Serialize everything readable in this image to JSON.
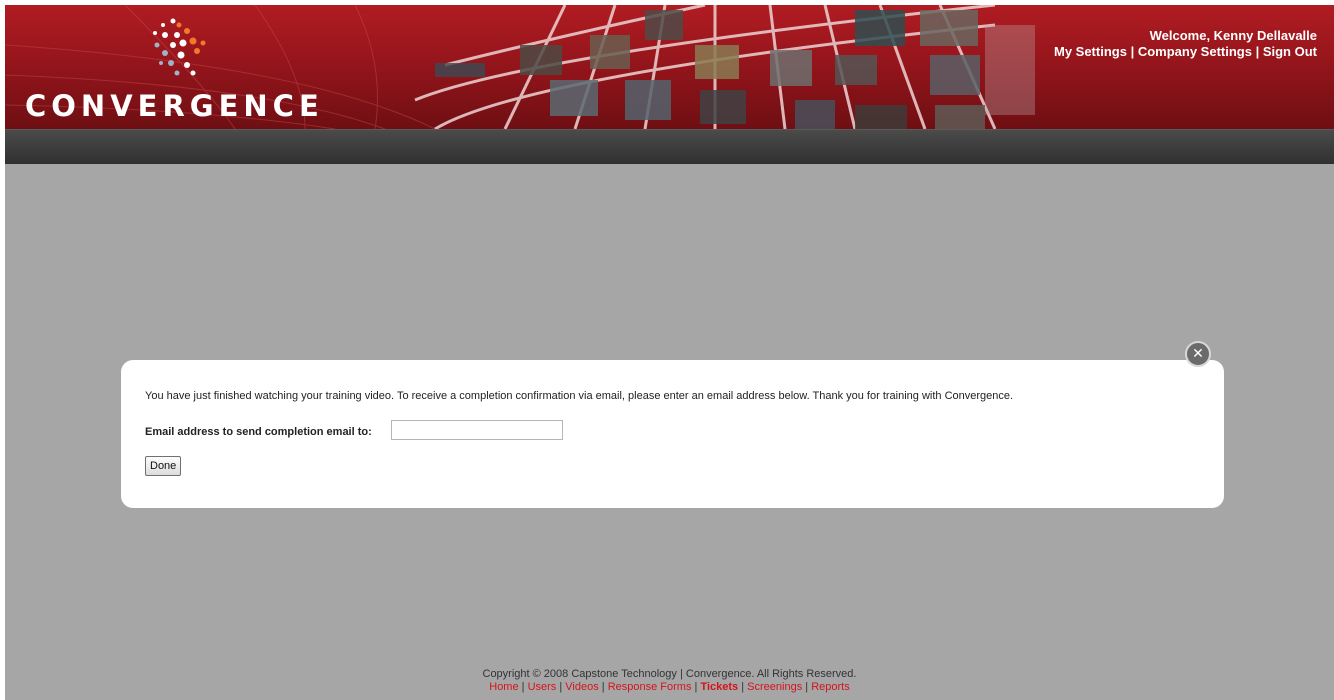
{
  "header": {
    "logo_text": "CONVERGENCE",
    "welcome": "Welcome, Kenny Dellavalle",
    "links": [
      "My Settings",
      "Company Settings",
      "Sign Out"
    ],
    "separator": " | "
  },
  "modal": {
    "message": "You have just finished watching your training video. To receive a completion confirmation via email, please enter an email address below. Thank you for training with Convergence.",
    "email_label": "Email address to send completion email to:",
    "email_value": "",
    "done_label": "Done",
    "close_glyph": "✕"
  },
  "footer": {
    "copyright": "Copyright © 2008 Capstone Technology | Convergence. All Rights Reserved.",
    "links": [
      "Home",
      "Users",
      "Videos",
      "Response Forms",
      "Tickets",
      "Screenings",
      "Reports"
    ],
    "separator": " | "
  },
  "colors": {
    "brand_red": "#a8191f",
    "nav_dark": "#3a3a3a",
    "overlay_gray": "#a6a6a6",
    "footer_link": "#d4141b"
  }
}
